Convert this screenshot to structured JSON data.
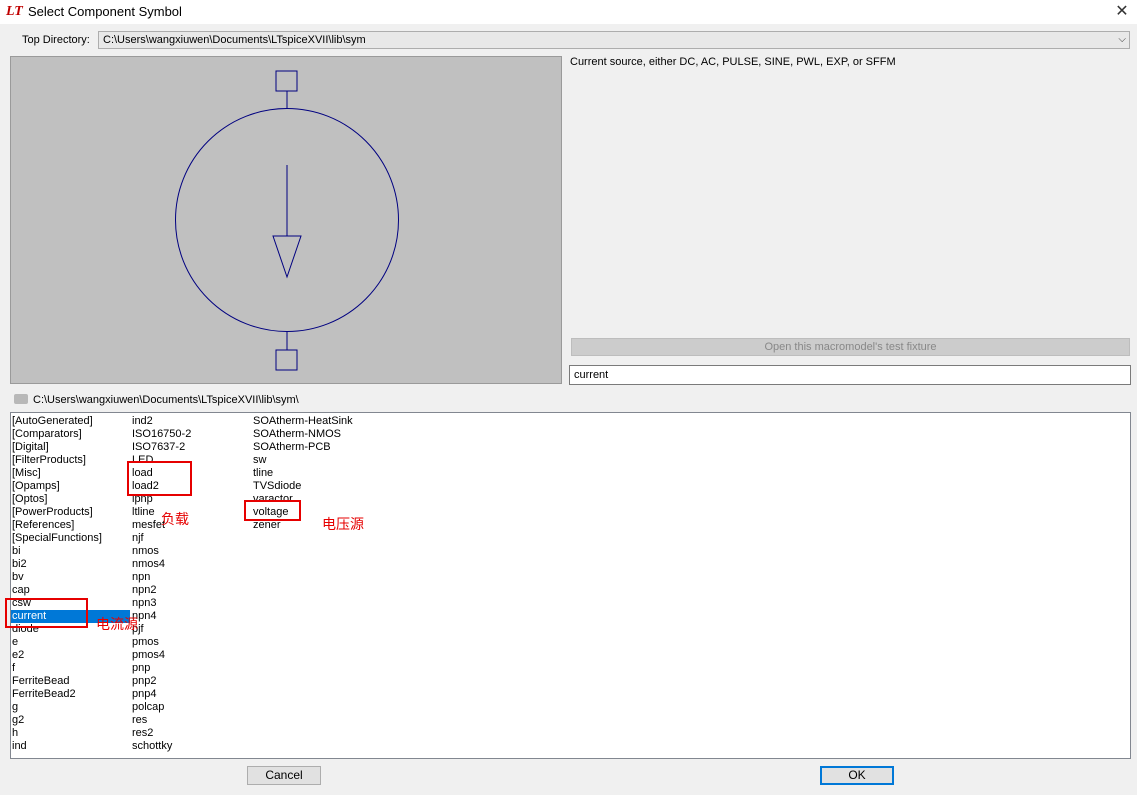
{
  "window": {
    "title": "Select Component Symbol",
    "app_icon": "LT",
    "close_glyph": "✕"
  },
  "top_directory": {
    "label": "Top Directory:",
    "value": "C:\\Users\\wangxiuwen\\Documents\\LTspiceXVII\\lib\\sym"
  },
  "preview": {
    "symbol": "current-source-icon",
    "stroke_color": "#000080",
    "background": "#c0c0c0"
  },
  "description": "Current source, either DC, AC, PULSE, SINE, PWL, EXP, or SFFM",
  "fixture_button": "Open this macromodel's test fixture",
  "search": {
    "value": "current"
  },
  "path": "C:\\Users\\wangxiuwen\\Documents\\LTspiceXVII\\lib\\sym\\",
  "list": {
    "columns": [
      [
        "[AutoGenerated]",
        "[Comparators]",
        "[Digital]",
        "[FilterProducts]",
        "[Misc]",
        "[Opamps]",
        "[Optos]",
        "[PowerProducts]",
        "[References]",
        "[SpecialFunctions]",
        "bi",
        "bi2",
        "bv",
        "cap",
        "csw",
        "current",
        "diode",
        "e",
        "e2",
        "f",
        "FerriteBead",
        "FerriteBead2",
        "g",
        "g2",
        "h",
        "ind"
      ],
      [
        "ind2",
        "ISO16750-2",
        "ISO7637-2",
        "LED",
        "load",
        "load2",
        "lpnp",
        "ltline",
        "mesfet",
        "njf",
        "nmos",
        "nmos4",
        "npn",
        "npn2",
        "npn3",
        "npn4",
        "pjf",
        "pmos",
        "pmos4",
        "pnp",
        "pnp2",
        "pnp4",
        "polcap",
        "res",
        "res2",
        "schottky"
      ],
      [
        "SOAtherm-HeatSink",
        "SOAtherm-NMOS",
        "SOAtherm-PCB",
        "sw",
        "tline",
        "TVSdiode",
        "varactor",
        "voltage",
        "zener"
      ]
    ],
    "selected": "current",
    "selection_color": "#0078d7"
  },
  "annotations": {
    "load_note": "负载",
    "voltage_note": "电压源",
    "current_note": "电流源",
    "color": "#e60000"
  },
  "buttons": {
    "cancel": "Cancel",
    "ok": "OK"
  }
}
